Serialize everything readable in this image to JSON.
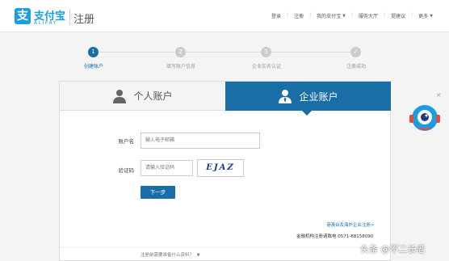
{
  "header": {
    "logo_glyph": "支",
    "logo_cn": "支付宝",
    "logo_en": "ALIPAY",
    "page_name": "注册",
    "nav": [
      {
        "label": "登录",
        "dropdown": false
      },
      {
        "label": "注册",
        "dropdown": false
      },
      {
        "label": "我的支付宝",
        "dropdown": true
      },
      {
        "label": "服务大厅",
        "dropdown": false
      },
      {
        "label": "提建议",
        "dropdown": false
      },
      {
        "label": "更多",
        "dropdown": true
      }
    ]
  },
  "steps": [
    {
      "num": "1",
      "label": "创建账户",
      "active": true
    },
    {
      "num": "2",
      "label": "填写账户信息",
      "active": false
    },
    {
      "num": "3",
      "label": "企业实名认证",
      "active": false
    },
    {
      "num": "✓",
      "label": "注册成功",
      "active": false
    }
  ],
  "tabs": {
    "personal": "个人账户",
    "business": "企业账户"
  },
  "form": {
    "account_label": "账户名",
    "account_placeholder": "输入电子邮箱",
    "captcha_label": "验证码",
    "captcha_placeholder": "请输入验证码",
    "captcha_text": "EJAZ",
    "next_label": "下一步"
  },
  "footer": {
    "intl_link": "港澳台及海外企业注册>",
    "hotline": "金融机构注册请致电 0571-88158090",
    "question": "注册前需要准备什么资料？"
  },
  "watermark": "头条 @不二长老",
  "colors": {
    "accent": "#1a6ea8",
    "brand": "#1a9ee0"
  }
}
